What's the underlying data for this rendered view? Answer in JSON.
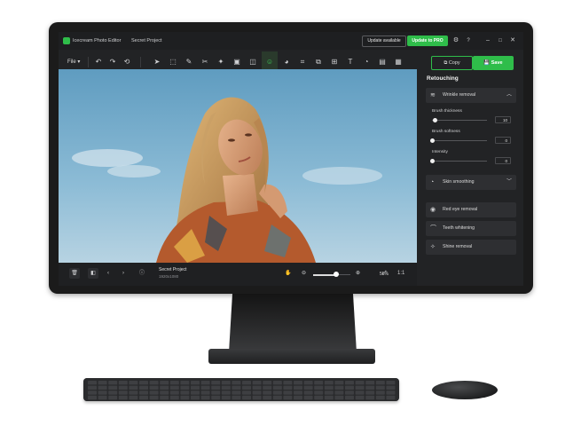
{
  "app": {
    "name": "Icecream Photo Editor",
    "project": "Secret Project",
    "update_label": "Update available",
    "pro_label": "Update to PRO",
    "window_controls": [
      "gear-icon",
      "help-icon",
      "minimize-icon",
      "maximize-icon",
      "close-icon"
    ]
  },
  "toolbar": {
    "file_label": "File",
    "copy_label": "Copy",
    "save_label": "Save",
    "tools": [
      "undo-icon",
      "redo-icon",
      "reset-icon",
      "select-icon",
      "crop-select-icon",
      "brush-icon",
      "magic-wand-icon",
      "clone-icon",
      "image-icon",
      "frame-icon",
      "retouch-icon",
      "color-icon",
      "crop-icon",
      "resize-icon",
      "transform-icon",
      "text-icon",
      "drop-icon",
      "layout-icon",
      "collage-icon"
    ],
    "active_tool": "retouch-icon"
  },
  "panel": {
    "title": "Retouching",
    "wrinkle": {
      "label": "Wrinkle removal",
      "brush_thickness": {
        "label": "Brush thickness",
        "value": "10",
        "fraction": 0.05
      },
      "brush_softness": {
        "label": "Brush softness",
        "value": "0",
        "fraction": 0.0
      },
      "intensity": {
        "label": "Intensity",
        "value": "0",
        "fraction": 0.0
      }
    },
    "skin_smoothing": "Skin smoothing",
    "red_eye": "Red eye removal",
    "teeth": "Teeth whitening",
    "shine": "Shine removal"
  },
  "status": {
    "name": "Secret Project",
    "dimensions": "1920x1080",
    "zoom": "55%",
    "zoom_fraction": 0.62,
    "one_to_one": "1:1"
  },
  "colors": {
    "accent": "#2fbd4a",
    "bg": "#222325",
    "sky": "#6fa7c7"
  }
}
